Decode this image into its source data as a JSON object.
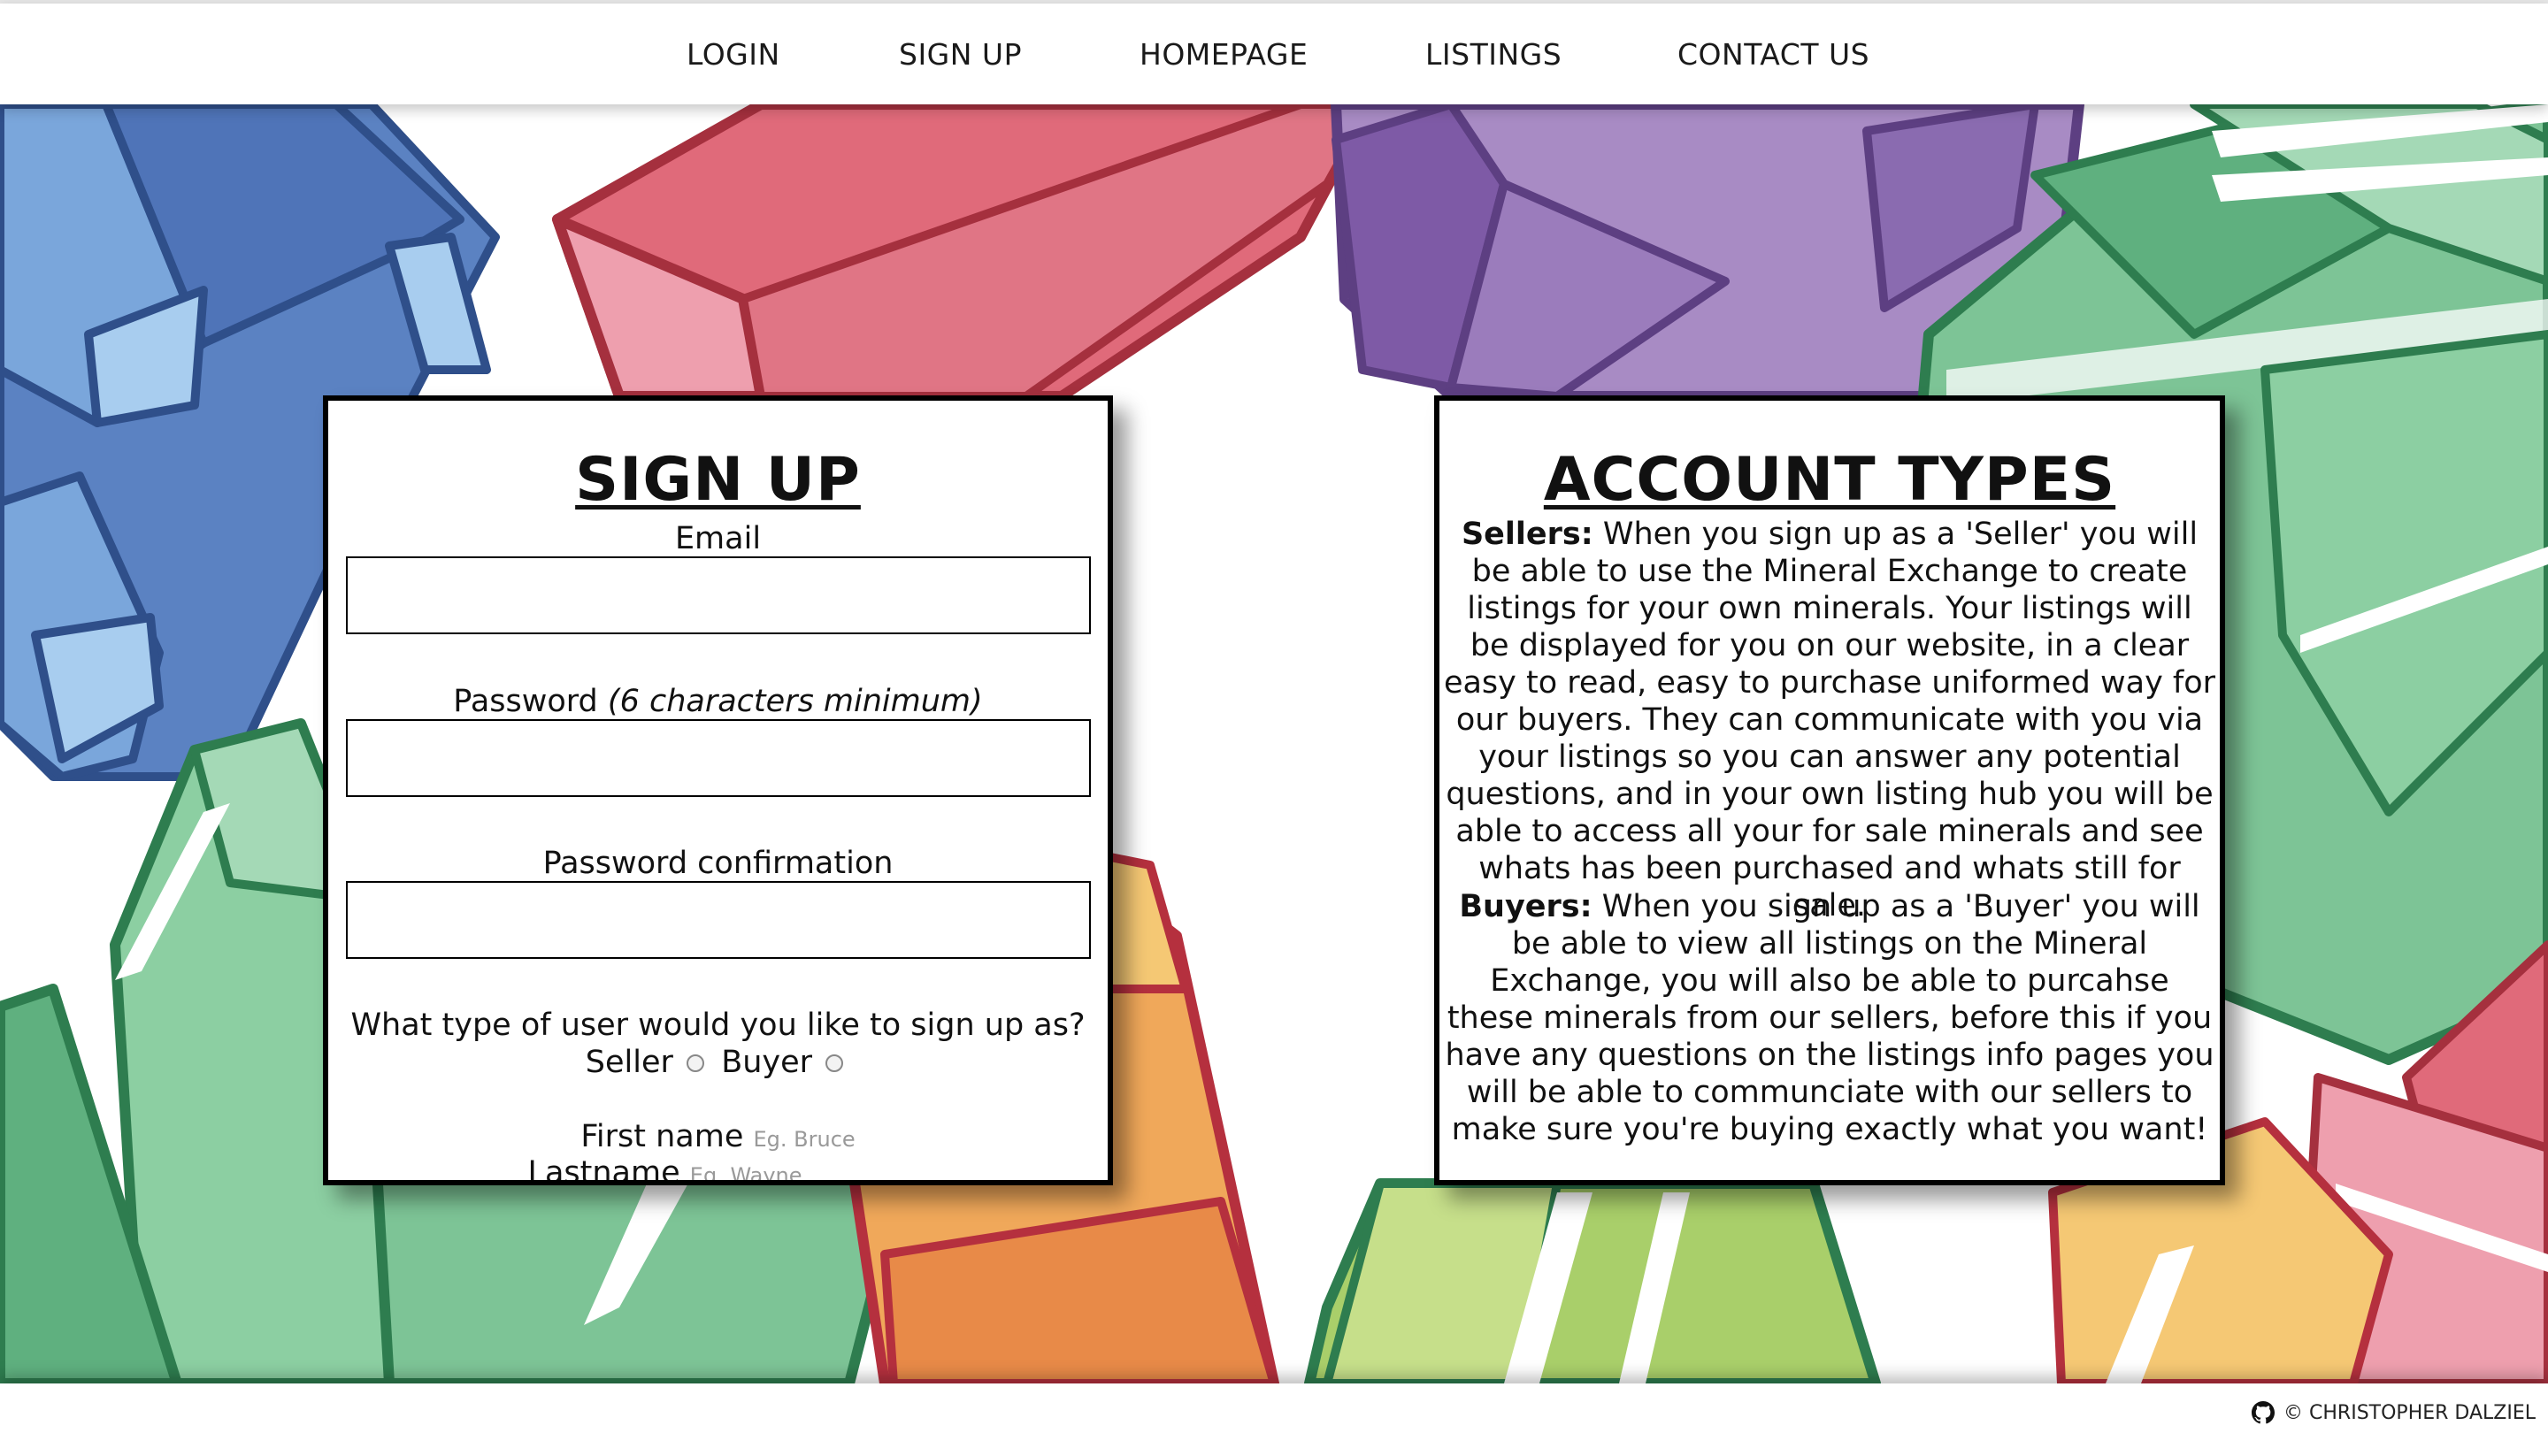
{
  "nav": {
    "items": [
      {
        "label": "LOGIN"
      },
      {
        "label": "SIGN UP"
      },
      {
        "label": "HOMEPAGE"
      },
      {
        "label": "LISTINGS"
      },
      {
        "label": "CONTACT US"
      }
    ]
  },
  "signup": {
    "title": "SIGN UP",
    "email_label": "Email",
    "password_label": "Password",
    "password_hint": "(6 characters minimum)",
    "password_confirm_label": "Password confirmation",
    "user_type_question": "What type of user would you like to sign up as?",
    "seller_label": "Seller",
    "buyer_label": "Buyer",
    "first_name_label": "First name",
    "first_name_placeholder": "Eg. Bruce",
    "last_name_label": "Lastname",
    "last_name_placeholder": "Eg. Wayne"
  },
  "account_types": {
    "title": "ACCOUNT TYPES",
    "sellers_heading": "Sellers:",
    "sellers_text": "When you sign up as a 'Seller' you will be able to use the Mineral Exchange to create listings for your own minerals. Your listings will be displayed for you on our website, in a clear easy to read, easy to purchase uniformed way for our buyers. They can communicate with you via your listings so you can answer any potential questions, and in your own listing hub you will be able to access all your for sale minerals and see whats has been purchased and whats still for sale.",
    "buyers_heading": "Buyers:",
    "buyers_text": "When you sign up as a 'Buyer' you will be able to view all listings on the Mineral Exchange, you will also be able to purcahse these minerals from our sellers, before this if you have any questions on the listings info pages you will be able to communciate with our sellers to make sure you're buying exactly what you want!"
  },
  "footer": {
    "credit": "© CHRISTOPHER DALZIEL",
    "icon": "github-icon"
  },
  "colors": {
    "blue": "#5b82c2",
    "red": "#e06a7a",
    "purple": "#9a7cb8",
    "green": "#6fbf8a",
    "orange": "#f0a85a",
    "lime": "#a9cf6a"
  }
}
